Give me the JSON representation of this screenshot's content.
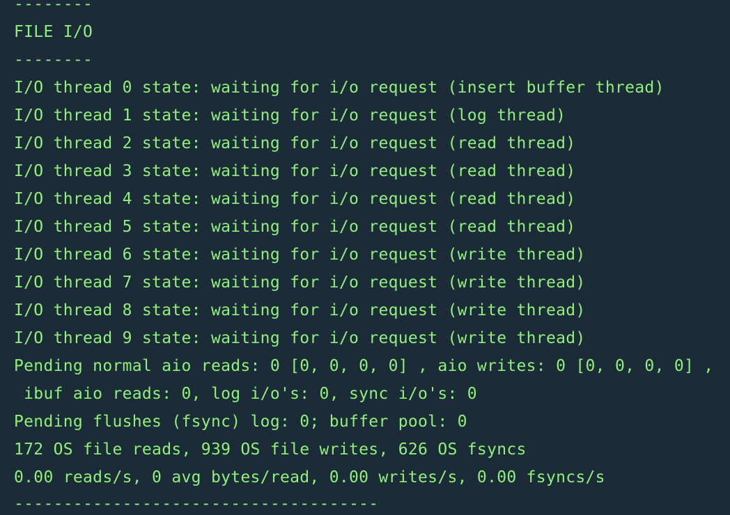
{
  "terminal": {
    "text_color": "#8ff07a",
    "background_color": "#1c2b38",
    "lines": [
      "--------",
      "FILE I/O",
      "--------",
      "I/O thread 0 state: waiting for i/o request (insert buffer thread)",
      "I/O thread 1 state: waiting for i/o request (log thread)",
      "I/O thread 2 state: waiting for i/o request (read thread)",
      "I/O thread 3 state: waiting for i/o request (read thread)",
      "I/O thread 4 state: waiting for i/o request (read thread)",
      "I/O thread 5 state: waiting for i/o request (read thread)",
      "I/O thread 6 state: waiting for i/o request (write thread)",
      "I/O thread 7 state: waiting for i/o request (write thread)",
      "I/O thread 8 state: waiting for i/o request (write thread)",
      "I/O thread 9 state: waiting for i/o request (write thread)",
      "Pending normal aio reads: 0 [0, 0, 0, 0] , aio writes: 0 [0, 0, 0, 0] ,",
      " ibuf aio reads: 0, log i/o's: 0, sync i/o's: 0",
      "Pending flushes (fsync) log: 0; buffer pool: 0",
      "172 OS file reads, 939 OS file writes, 626 OS fsyncs",
      "0.00 reads/s, 0 avg bytes/read, 0.00 writes/s, 0.00 fsyncs/s",
      "-------------------------------------"
    ]
  }
}
